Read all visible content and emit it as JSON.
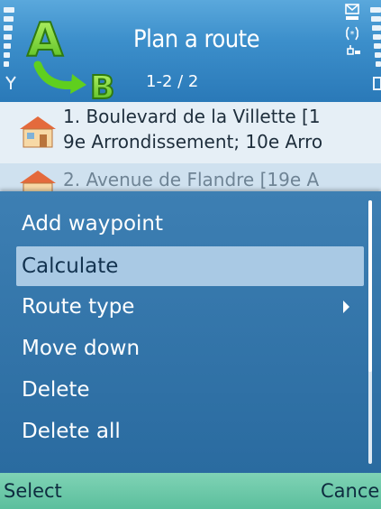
{
  "title_pane": {
    "title": "Plan a route",
    "subtitle": "1-2 / 2",
    "app_icon": "route-a-to-b-icon",
    "app_icon_letters": {
      "start": "A",
      "end": "B"
    },
    "indicators": [
      "message-icon",
      "bluetooth-icon",
      "keylock-icon"
    ]
  },
  "route_list": {
    "items": [
      {
        "line1": "1. Boulevard de la Villette [1",
        "line2": "9e Arrondissement; 10e Arro",
        "icon": "house-icon"
      },
      {
        "line1": "2. Avenue de Flandre [19e A",
        "icon": "house-icon"
      }
    ]
  },
  "menu": {
    "items": [
      {
        "label": "Add waypoint"
      },
      {
        "label": "Calculate",
        "highlighted": true
      },
      {
        "label": "Route type",
        "submenu": true
      },
      {
        "label": "Move down"
      },
      {
        "label": "Delete"
      },
      {
        "label": "Delete all"
      }
    ]
  },
  "softkeys": {
    "left": "Select",
    "right": "Cance"
  },
  "colors": {
    "title_bg": "#3c8fcb",
    "menu_bg": "#2f72a8",
    "highlight": "#a9c9e4",
    "softkey_bg": "#6cc9a8",
    "icon_green": "#7ddc2a"
  }
}
